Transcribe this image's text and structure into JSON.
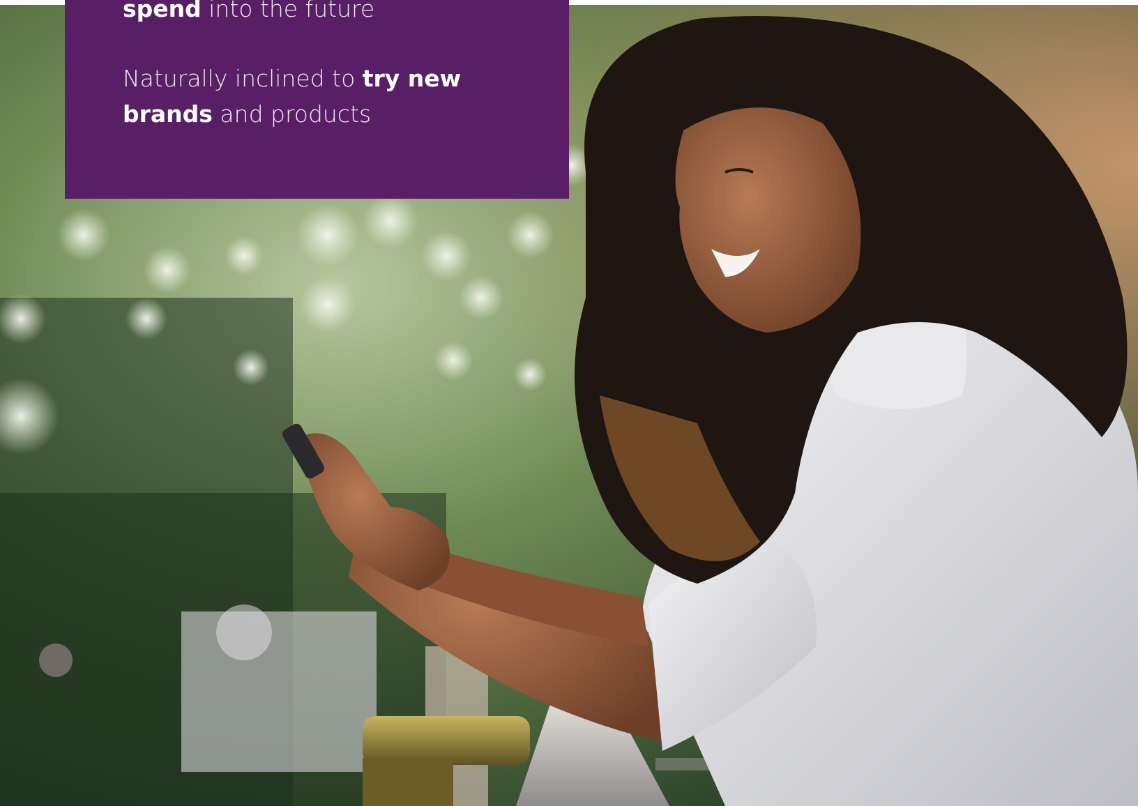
{
  "colors": {
    "callout_bg": "#581f66",
    "callout_text": "#f3eaf5"
  },
  "callout": {
    "line1": {
      "bold": "spend",
      "rest": " into the future"
    },
    "line2": {
      "lead": "Naturally inclined to ",
      "bold": "try new"
    },
    "line3": {
      "bold": "brands",
      "rest": " and products"
    }
  },
  "photo": {
    "subject": "woman smiling at smartphone on balcony"
  }
}
